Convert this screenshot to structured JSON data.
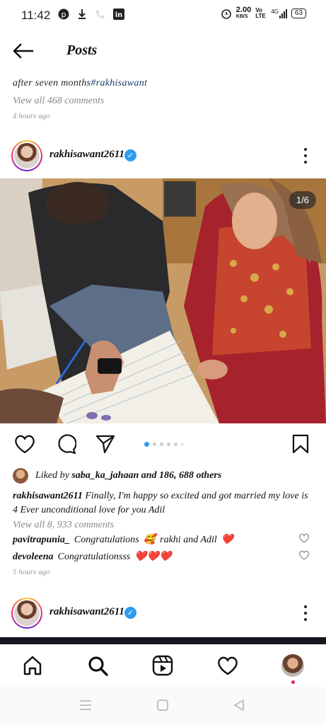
{
  "status_bar": {
    "time": "11:42",
    "speed_value": "2.00",
    "speed_unit": "KB/S",
    "network_label": "Vo LTE",
    "signal_label": "4G",
    "battery": "63"
  },
  "header": {
    "title": "Posts"
  },
  "previous_post": {
    "caption_text": "after seven months",
    "caption_tag": "#rakhisawant",
    "view_comments": "View all 468 comments",
    "time": "4 hours ago"
  },
  "post": {
    "username": "rakhisawant2611",
    "counter": "1/6",
    "liked_by_prefix": "Liked by",
    "liked_by_user": "saba_ka_jahaan",
    "liked_by_suffix": "and 186, 688 others",
    "caption_user": "rakhisawant2611",
    "caption_text": "Finally,  I'm happy so excited and got married my love is 4 Ever unconditional love for you Adil",
    "view_comments": "View all 8, 933 comments",
    "comments": [
      {
        "user": "pavitrapunia_",
        "text": "Congratulations",
        "emoji": "🥰",
        "text2": "rakhi and Adil",
        "emoji2": "❤️"
      },
      {
        "user": "devoleena",
        "text": "Congratulationsss",
        "emoji": "❤️❤️❤️"
      }
    ],
    "time": "5 hours ago",
    "active_slide": 1,
    "total_slides": 6
  },
  "next_post": {
    "username": "rakhisawant2611"
  },
  "icons": {
    "like": "heart-icon",
    "comment": "comment-icon",
    "share": "send-icon",
    "save": "bookmark-icon",
    "home": "home-icon",
    "search": "search-icon",
    "reels": "reels-icon",
    "activity": "heart-icon"
  },
  "colors": {
    "verified": "#2d9bf0",
    "carousel_active": "#2d9bf0",
    "notification_dot": "#e0245e"
  }
}
